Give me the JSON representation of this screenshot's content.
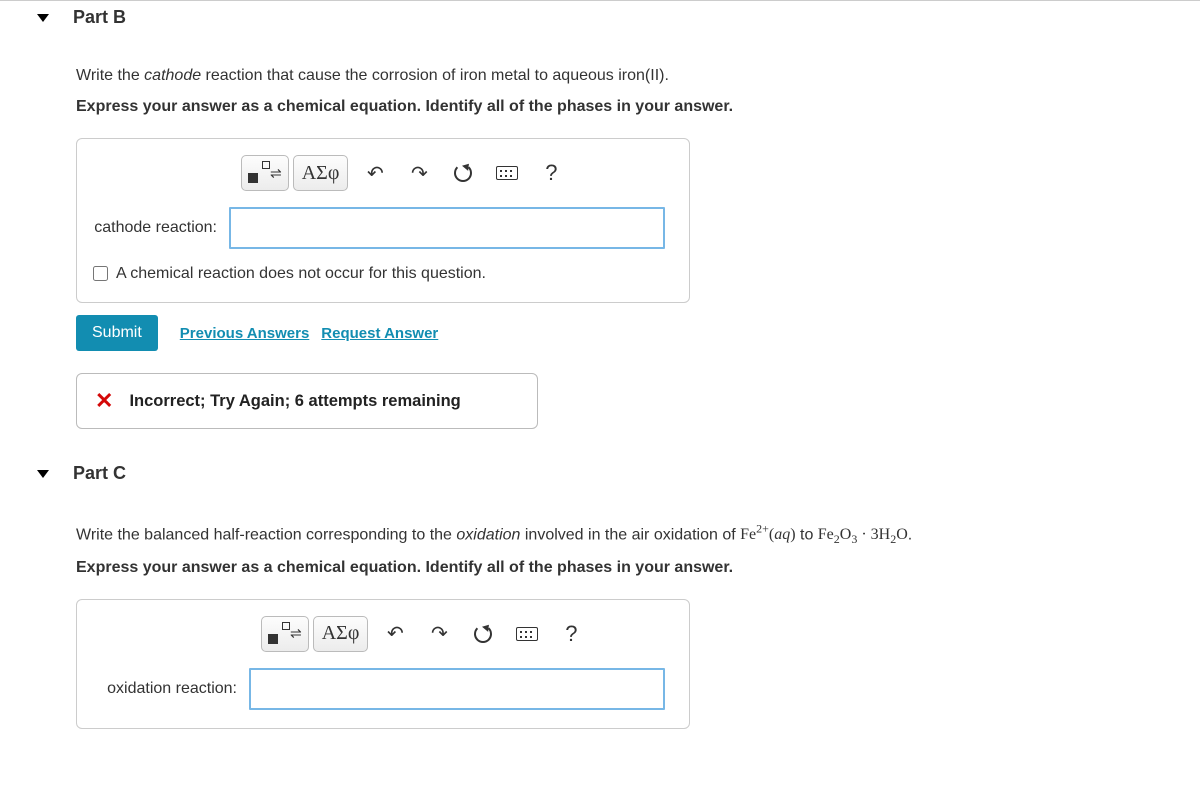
{
  "partB": {
    "title": "Part B",
    "prompt_html": "Write the <em>cathode</em> reaction that cause the corrosion of iron metal to aqueous iron(II).",
    "instruction": "Express your answer as a chemical equation. Identify all of the phases in your answer.",
    "input_label": "cathode reaction:",
    "input_value": "",
    "checkbox_label": "A chemical reaction does not occur for this question.",
    "submit": "Submit",
    "prev_answers": "Previous Answers",
    "request_answer": "Request Answer",
    "feedback": "Incorrect; Try Again; 6 attempts remaining",
    "toolbar": {
      "greek": "ΑΣφ",
      "help": "?"
    }
  },
  "partC": {
    "title": "Part C",
    "prompt_prefix": "Write the balanced half-reaction corresponding to the ",
    "prompt_em": "oxidation",
    "prompt_mid": " involved in the air oxidation of ",
    "prompt_species1": "Fe²⁺(aq)",
    "prompt_to": " to ",
    "prompt_species2": "Fe₂O₃ · 3H₂O",
    "prompt_end": ".",
    "instruction": "Express your answer as a chemical equation. Identify all of the phases in your answer.",
    "input_label": "oxidation reaction:",
    "input_value": "",
    "toolbar": {
      "greek": "ΑΣφ",
      "help": "?"
    }
  }
}
